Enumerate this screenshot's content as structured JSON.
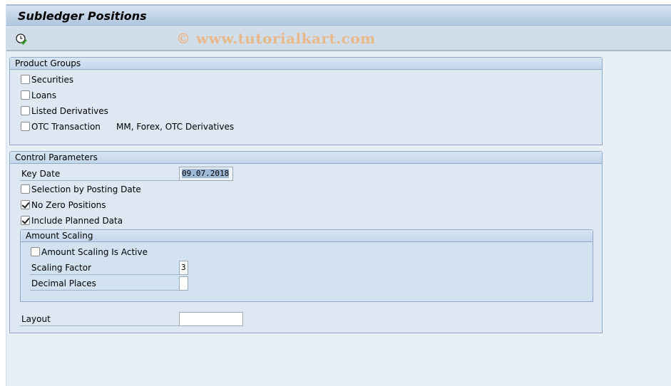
{
  "window": {
    "title": "Subledger Positions",
    "watermark": "© www.tutorialkart.com"
  },
  "toolbar": {
    "execute_icon": "execute-clock-check-icon"
  },
  "product_groups": {
    "title": "Product Groups",
    "items": [
      {
        "label": "Securities",
        "checked": false
      },
      {
        "label": "Loans",
        "checked": false
      },
      {
        "label": "Listed Derivatives",
        "checked": false
      },
      {
        "label": "OTC Transaction",
        "checked": false,
        "note": "MM, Forex, OTC Derivatives"
      }
    ]
  },
  "control_parameters": {
    "title": "Control Parameters",
    "key_date": {
      "label": "Key Date",
      "value": "09.07.2018"
    },
    "selection_by_posting_date": {
      "label": "Selection by Posting Date",
      "checked": false
    },
    "no_zero_positions": {
      "label": "No Zero Positions",
      "checked": true
    },
    "include_planned_data": {
      "label": "Include Planned Data",
      "checked": true
    },
    "amount_scaling": {
      "title": "Amount Scaling",
      "active": {
        "label": "Amount Scaling Is Active",
        "checked": false
      },
      "scaling_factor": {
        "label": "Scaling Factor",
        "value": "3"
      },
      "decimal_places": {
        "label": "Decimal Places",
        "value": ""
      }
    },
    "layout": {
      "label": "Layout",
      "value": ""
    }
  }
}
